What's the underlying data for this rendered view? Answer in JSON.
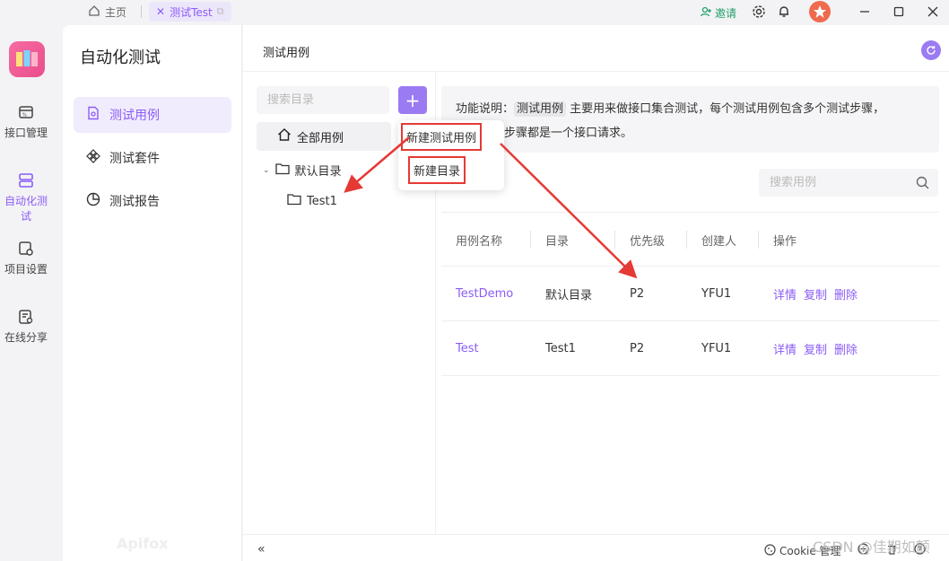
{
  "titlebar": {
    "home_tab": "主页",
    "active_tab": "测试Test",
    "invite": "邀请"
  },
  "rail": {
    "items": [
      {
        "label": "接口管理"
      },
      {
        "label": "自动化测试"
      },
      {
        "label": "项目设置"
      },
      {
        "label": "在线分享"
      }
    ]
  },
  "nav2": {
    "title": "自动化测试",
    "items": [
      {
        "label": "测试用例"
      },
      {
        "label": "测试套件"
      },
      {
        "label": "测试报告"
      }
    ],
    "brand": "Apifox"
  },
  "main": {
    "title": "测试用例"
  },
  "tree": {
    "search_placeholder": "搜索目录",
    "all_cases": "全部用例",
    "default_dir": "默认目录",
    "sub_dir": "Test1"
  },
  "popup": {
    "new_case": "新建测试用例",
    "new_dir": "新建目录"
  },
  "desc": {
    "prefix": "功能说明：",
    "highlight": "测试用例",
    "line1_rest": " 主要用来做接口集合测试，每个测试用例包含多个测试步骤，",
    "line2": "步骤都是一个接口请求。"
  },
  "case_search": {
    "placeholder": "搜索用例"
  },
  "table": {
    "headers": [
      "用例名称",
      "目录",
      "优先级",
      "创建人",
      "操作"
    ],
    "rows": [
      {
        "name": "TestDemo",
        "dir": "默认目录",
        "priority": "P2",
        "creator": "YFU1"
      },
      {
        "name": "Test",
        "dir": "Test1",
        "priority": "P2",
        "creator": "YFU1"
      }
    ],
    "ops": {
      "detail": "详情",
      "copy": "复制",
      "delete": "删除"
    }
  },
  "footer": {
    "collapse": "«",
    "cookie": "Cookie 管理"
  },
  "watermark": "CSDN @佳期如颤",
  "colors": {
    "accent": "#8b5cf6",
    "annotation": "#e53935"
  }
}
